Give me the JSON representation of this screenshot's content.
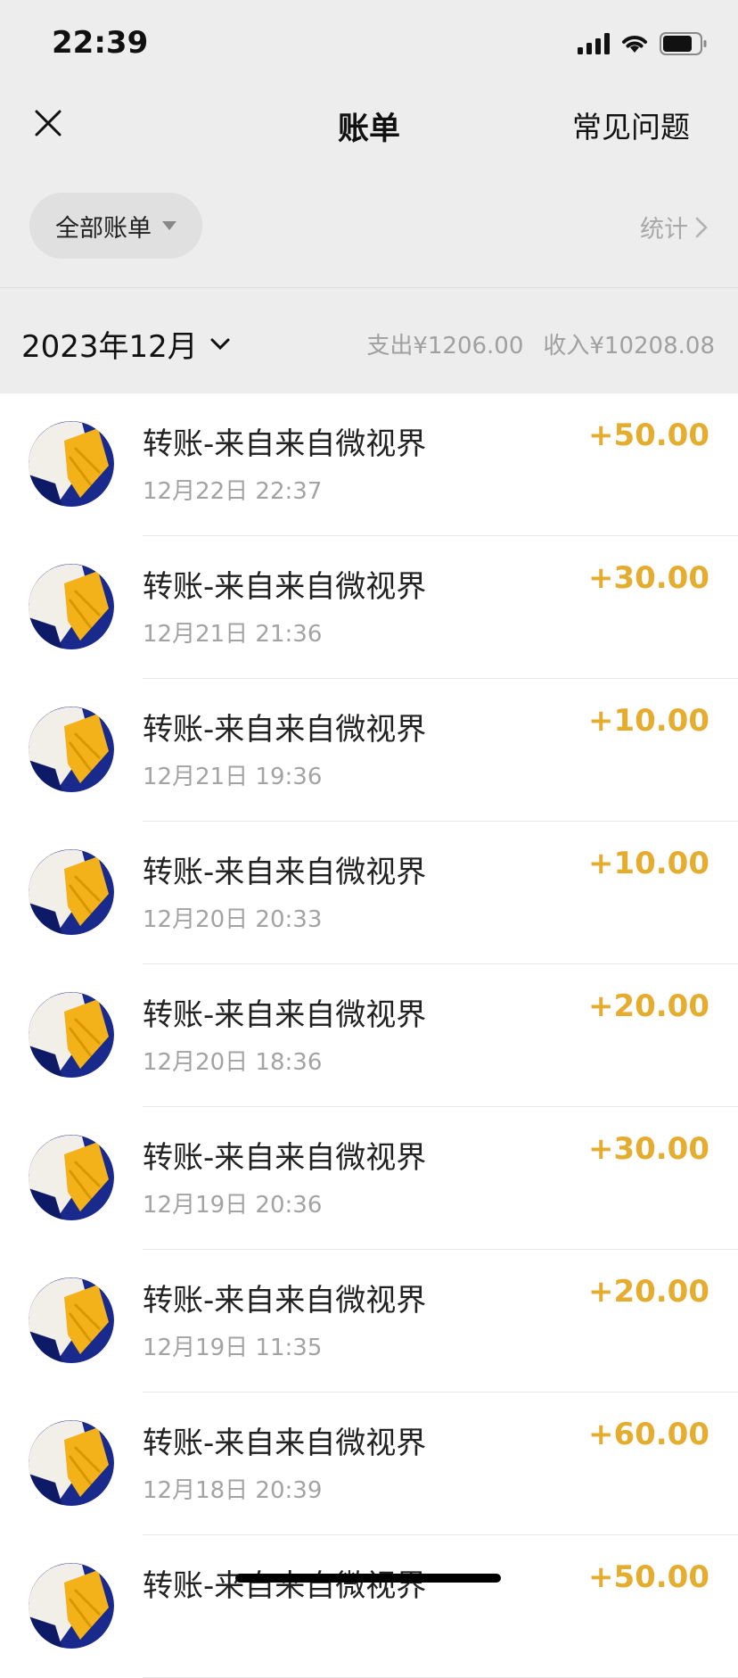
{
  "status_bar": {
    "time": "22:39"
  },
  "nav": {
    "title": "账单",
    "faq": "常见问题"
  },
  "filter": {
    "label": "全部账单",
    "stats": "统计"
  },
  "month": {
    "label": "2023年12月",
    "expense": "支出¥1206.00",
    "income": "收入¥10208.08"
  },
  "transactions": [
    {
      "title": "转账-来自来自微视界",
      "time": "12月22日 22:37",
      "amount": "+50.00"
    },
    {
      "title": "转账-来自来自微视界",
      "time": "12月21日 21:36",
      "amount": "+30.00"
    },
    {
      "title": "转账-来自来自微视界",
      "time": "12月21日 19:36",
      "amount": "+10.00"
    },
    {
      "title": "转账-来自来自微视界",
      "time": "12月20日 20:33",
      "amount": "+10.00"
    },
    {
      "title": "转账-来自来自微视界",
      "time": "12月20日 18:36",
      "amount": "+20.00"
    },
    {
      "title": "转账-来自来自微视界",
      "time": "12月19日 20:36",
      "amount": "+30.00"
    },
    {
      "title": "转账-来自来自微视界",
      "time": "12月19日 11:35",
      "amount": "+20.00"
    },
    {
      "title": "转账-来自来自微视界",
      "time": "12月18日 20:39",
      "amount": "+60.00"
    },
    {
      "title": "转账-来自来自微视界",
      "time": "",
      "amount": "+50.00"
    }
  ],
  "colors": {
    "background": "#ededed",
    "amount": "#e4ad2f",
    "secondary_text": "#a3a3a3"
  },
  "icons": [
    "signal-icon",
    "wifi-icon",
    "battery-icon",
    "close-icon",
    "chevron-down-icon",
    "chevron-right-icon",
    "avatar-image"
  ]
}
